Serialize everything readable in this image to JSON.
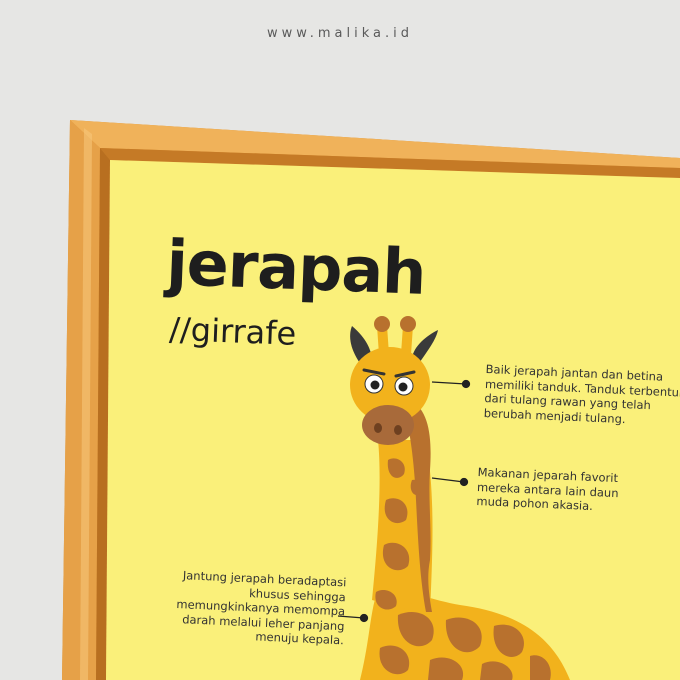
{
  "site_url": "www.malika.id",
  "poster": {
    "title": "jerapah",
    "subtitle": "//girrafe",
    "facts": [
      {
        "lines": [
          "Baik jerapah jantan dan betina",
          "memiliki tanduk. Tanduk terbentuk",
          "dari tulang rawan yang telah",
          "berubah menjadi tulang."
        ]
      },
      {
        "lines": [
          "Makanan jeparah favorit",
          "mereka antara lain daun",
          "muda pohon akasia."
        ]
      },
      {
        "lines": [
          "Jantung jerapah beradaptasi",
          "khusus sehingga",
          "memungkinkanya memompa",
          "darah melalui leher panjang",
          "menuju kepala."
        ]
      }
    ]
  },
  "colors": {
    "background": "#e6e6e4",
    "poster": "#faf07a",
    "frame": "#e8a347",
    "giraffe_body": "#f2b21c",
    "giraffe_spots": "#b8712e",
    "text": "#1e1e1e"
  }
}
